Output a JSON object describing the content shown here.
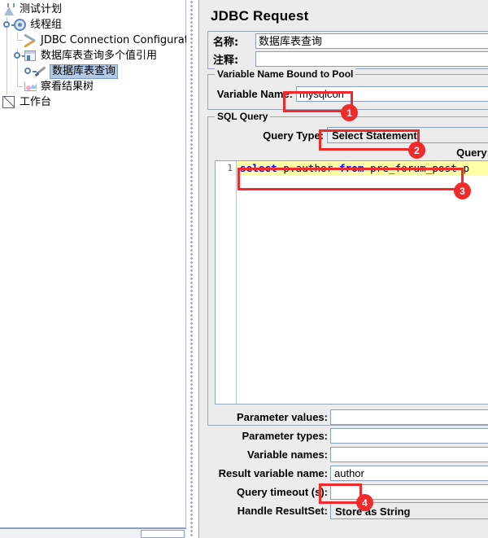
{
  "tree": {
    "items": [
      {
        "label": "测试计划",
        "icon": "test-plan-flask-icon",
        "depth": 0,
        "selected": false
      },
      {
        "label": "线程组",
        "icon": "thread-group-gear-icon",
        "depth": 1,
        "selected": false
      },
      {
        "label": "JDBC Connection Configuration",
        "icon": "config-tools-icon",
        "depth": 2,
        "selected": false
      },
      {
        "label": "数据库表查询多个值引用",
        "icon": "logic-controller-icon",
        "depth": 2,
        "selected": false
      },
      {
        "label": "数据库表查询",
        "icon": "jdbc-sampler-pipette-icon",
        "depth": 3,
        "selected": true
      },
      {
        "label": "察看结果树",
        "icon": "view-results-tree-icon",
        "depth": 2,
        "selected": false
      },
      {
        "label": "工作台",
        "icon": "workbench-icon",
        "depth": 0,
        "selected": false
      }
    ]
  },
  "panel": {
    "title": "JDBC Request",
    "name_label": "名称:",
    "name_value": "数据库表查询",
    "comment_label": "注释:",
    "comment_value": "",
    "pool_group_title": "Variable Name Bound to Pool",
    "variable_name_label": "Variable Name:",
    "variable_name_value": "mysqlcon",
    "sql_group_title": "SQL Query",
    "query_type_label": "Query Type:",
    "query_type_value": "Select Statement",
    "query_caption": "Query:",
    "sql": {
      "line_number": "1",
      "tokens": [
        {
          "text": "select",
          "kind": "keyword"
        },
        {
          "text": " p.author ",
          "kind": "plain"
        },
        {
          "text": "from",
          "kind": "keyword"
        },
        {
          "text": " pre_forum_post p",
          "kind": "plain"
        }
      ],
      "full_text": "select p.author from pre_forum_post p"
    },
    "fields": [
      {
        "label": "Parameter values:",
        "value": "",
        "type": "text"
      },
      {
        "label": "Parameter types:",
        "value": "",
        "type": "text"
      },
      {
        "label": "Variable names:",
        "value": "",
        "type": "text"
      },
      {
        "label": "Result variable name:",
        "value": "author",
        "type": "text"
      },
      {
        "label": "Query timeout (s):",
        "value": "",
        "type": "text"
      },
      {
        "label": "Handle ResultSet:",
        "value": "Store as String",
        "type": "combo"
      }
    ]
  },
  "annotations": {
    "accent_color": "#ef2b2b",
    "badges": [
      {
        "number": "1",
        "target": "variable-name-input"
      },
      {
        "number": "2",
        "target": "query-type-combo"
      },
      {
        "number": "3",
        "target": "sql-query-line"
      },
      {
        "number": "4",
        "target": "result-variable-name-input"
      }
    ]
  }
}
